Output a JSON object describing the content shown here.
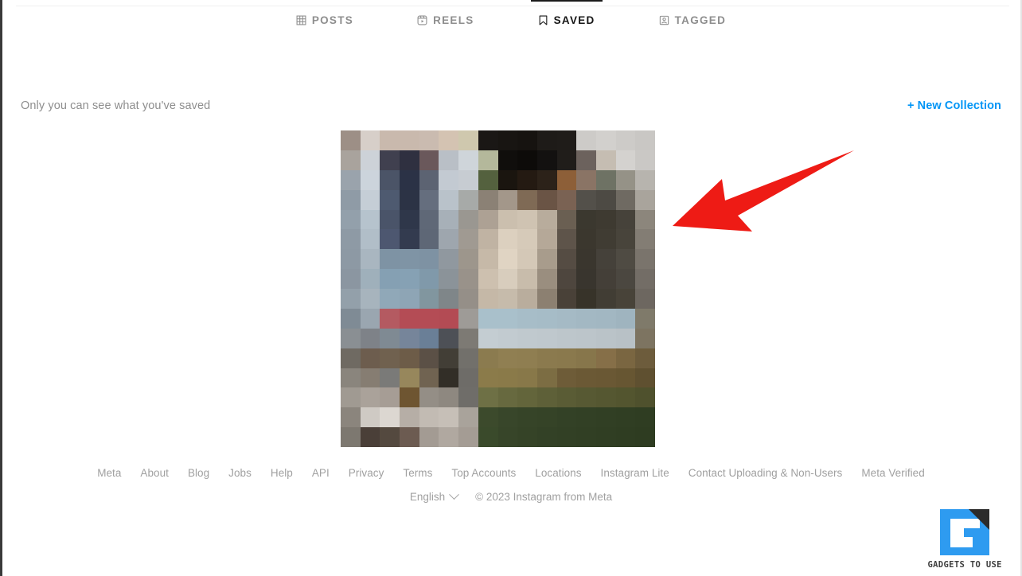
{
  "app": {
    "name": "Instagram",
    "accent_color": "#0095F6",
    "text_muted": "#8E8E8E",
    "text_primary": "#262626"
  },
  "profile_tabs": {
    "items": [
      {
        "label": "POSTS",
        "icon": "grid-icon",
        "active": false
      },
      {
        "label": "REELS",
        "icon": "reels-icon",
        "active": false
      },
      {
        "label": "SAVED",
        "icon": "bookmark-icon",
        "active": true
      },
      {
        "label": "TAGGED",
        "icon": "tagged-person-icon",
        "active": false
      }
    ]
  },
  "saved_section": {
    "privacy_note": "Only you can see what you've saved",
    "new_collection_label": "+ New Collection",
    "collections": [
      {
        "name": "saved-collection-thumbnail"
      }
    ]
  },
  "annotation": {
    "type": "arrow",
    "color": "#EE1B15",
    "direction": "down-left",
    "points_at": "saved-collection-thumbnail"
  },
  "footer": {
    "links": [
      "Meta",
      "About",
      "Blog",
      "Jobs",
      "Help",
      "API",
      "Privacy",
      "Terms",
      "Top Accounts",
      "Locations",
      "Instagram Lite",
      "Contact Uploading & Non-Users",
      "Meta Verified"
    ],
    "language": "English",
    "copyright": "© 2023 Instagram from Meta"
  },
  "watermark": {
    "text": "GADGETS TO USE",
    "brand_color": "#2E9BF0"
  },
  "thumbnail_mosaic": {
    "cols": 16,
    "rows": 16,
    "colors": [
      [
        "#9d8f86",
        "#d7cfc9",
        "#c9b9ad",
        "#c9b9ad",
        "#cabbb0",
        "#d4c3b2",
        "#cfc8ae",
        "#1a1715",
        "#181512",
        "#161310",
        "#1e1b18",
        "#1f1c19",
        "#cdcbc8",
        "#d2d0cd",
        "#cdcbc8",
        "#c9c7c4"
      ],
      [
        "#a9a39d",
        "#cdd2d8",
        "#40404f",
        "#2f3040",
        "#6a585b",
        "#b9bfc6",
        "#cfd5da",
        "#b4b89b",
        "#100e0c",
        "#0d0b09",
        "#131110",
        "#201d1a",
        "#6c625d",
        "#c5bdb2",
        "#d4d2cf",
        "#cac8c5"
      ],
      [
        "#9aa3ac",
        "#ccd4dc",
        "#4b5467",
        "#2b3246",
        "#5c6372",
        "#c3cad2",
        "#c7ccd2",
        "#54613e",
        "#1a150f",
        "#241a12",
        "#2c2219",
        "#8d5f38",
        "#8a7465",
        "#6e7264",
        "#959287",
        "#b7b4ae"
      ],
      [
        "#8f9ba6",
        "#c5ced6",
        "#4e5a70",
        "#2c3345",
        "#656e7e",
        "#b9c2ca",
        "#a7aaa8",
        "#8b8175",
        "#a3978a",
        "#7f6a55",
        "#6a5445",
        "#7a6253",
        "#53504a",
        "#4d4a44",
        "#6f6a62",
        "#a9a49c"
      ],
      [
        "#93a0ab",
        "#b6c3cd",
        "#4a5469",
        "#2f374a",
        "#5f6877",
        "#a7b0b8",
        "#9a9791",
        "#ada194",
        "#cbbfae",
        "#cfc3b2",
        "#b8ac9c",
        "#6a5f52",
        "#3b382f",
        "#3e3a31",
        "#46423a",
        "#8c867c"
      ],
      [
        "#8e9aa5",
        "#b1bec8",
        "#4d5770",
        "#333b4f",
        "#5e6776",
        "#9ea6ae",
        "#a09a92",
        "#c0b3a3",
        "#dcd0bf",
        "#d6cab9",
        "#b5a898",
        "#5e544a",
        "#3b372e",
        "#403c33",
        "#48443b",
        "#837d74"
      ],
      [
        "#8d99a4",
        "#a9b6c0",
        "#7e93a4",
        "#7f94a5",
        "#7e92a3",
        "#90989f",
        "#9d968c",
        "#c6b9a8",
        "#e0d4c3",
        "#d4c8b7",
        "#a89c8c",
        "#554c43",
        "#3a362e",
        "#45413a",
        "#4f4b43",
        "#7a746c"
      ],
      [
        "#8b96a1",
        "#9fb0bb",
        "#85a0b3",
        "#86a1b4",
        "#8099aa",
        "#8b9399",
        "#99928a",
        "#cdc0af",
        "#d8cdbd",
        "#c8bcab",
        "#9a8e7f",
        "#4e463e",
        "#39352e",
        "#443f38",
        "#4b4740",
        "#736d66"
      ],
      [
        "#93a0aa",
        "#a7b4bd",
        "#90a8b8",
        "#8ea5b5",
        "#81969f",
        "#7f8689",
        "#958f88",
        "#c5b8a7",
        "#c6bbab",
        "#b9ad9d",
        "#8c8071",
        "#494138",
        "#373329",
        "#413d34",
        "#484339",
        "#6d6760"
      ],
      [
        "#7f8b95",
        "#9aa6b0",
        "#b45a61",
        "#b44c55",
        "#b44c55",
        "#b34b54",
        "#9e9b97",
        "#a9c0cb",
        "#a9c0cb",
        "#a7bdc8",
        "#a6bcc7",
        "#a5bac5",
        "#a3b8c3",
        "#a2b7c2",
        "#9fb4bf",
        "#7f7a6a"
      ],
      [
        "#8a8f93",
        "#7e8288",
        "#7f8a93",
        "#76859a",
        "#6a7f97",
        "#4d5056",
        "#7d7a74",
        "#c4cdd2",
        "#c2cbd0",
        "#c0c9ce",
        "#bfc8cd",
        "#bdc6cb",
        "#bcc5ca",
        "#bac3c8",
        "#b8c1c6",
        "#7d7461"
      ],
      [
        "#6f6a62",
        "#6d5d4e",
        "#70614f",
        "#6d5c48",
        "#5b5046",
        "#423e36",
        "#72706b",
        "#8b7b4f",
        "#907f52",
        "#8f7e51",
        "#8b7a4e",
        "#8a794d",
        "#87764b",
        "#866f48",
        "#7a6641",
        "#6d5c3c"
      ],
      [
        "#8a857d",
        "#867d72",
        "#7a7a78",
        "#97875c",
        "#706351",
        "#322e27",
        "#6e6c68",
        "#8b7b4a",
        "#8a7a49",
        "#887849",
        "#7c6d43",
        "#6e5c38",
        "#6b5935",
        "#6a5834",
        "#675632",
        "#5f5030"
      ],
      [
        "#a09a92",
        "#aaa29a",
        "#a69d95",
        "#6e5531",
        "#948e86",
        "#8e8880",
        "#6f6d69",
        "#6e7045",
        "#67693f",
        "#63653b",
        "#5e6038",
        "#5a5c35",
        "#575933",
        "#555731",
        "#53552f",
        "#4f512d"
      ],
      [
        "#8b857d",
        "#cfcac4",
        "#dcd7d1",
        "#b6aea6",
        "#c2bbb3",
        "#c6bfb7",
        "#a9a39b",
        "#3c4a2c",
        "#38462a",
        "#364428",
        "#354327",
        "#334126",
        "#324025",
        "#313f24",
        "#303e23",
        "#2f3d22"
      ],
      [
        "#7d7870",
        "#4a3f38",
        "#54493f",
        "#6c5b51",
        "#a39b93",
        "#b0a8a0",
        "#a49c94",
        "#3a4a2b",
        "#374529",
        "#354327",
        "#334126",
        "#324025",
        "#313f24",
        "#303e23",
        "#2f3d22",
        "#2e3c21"
      ]
    ]
  }
}
